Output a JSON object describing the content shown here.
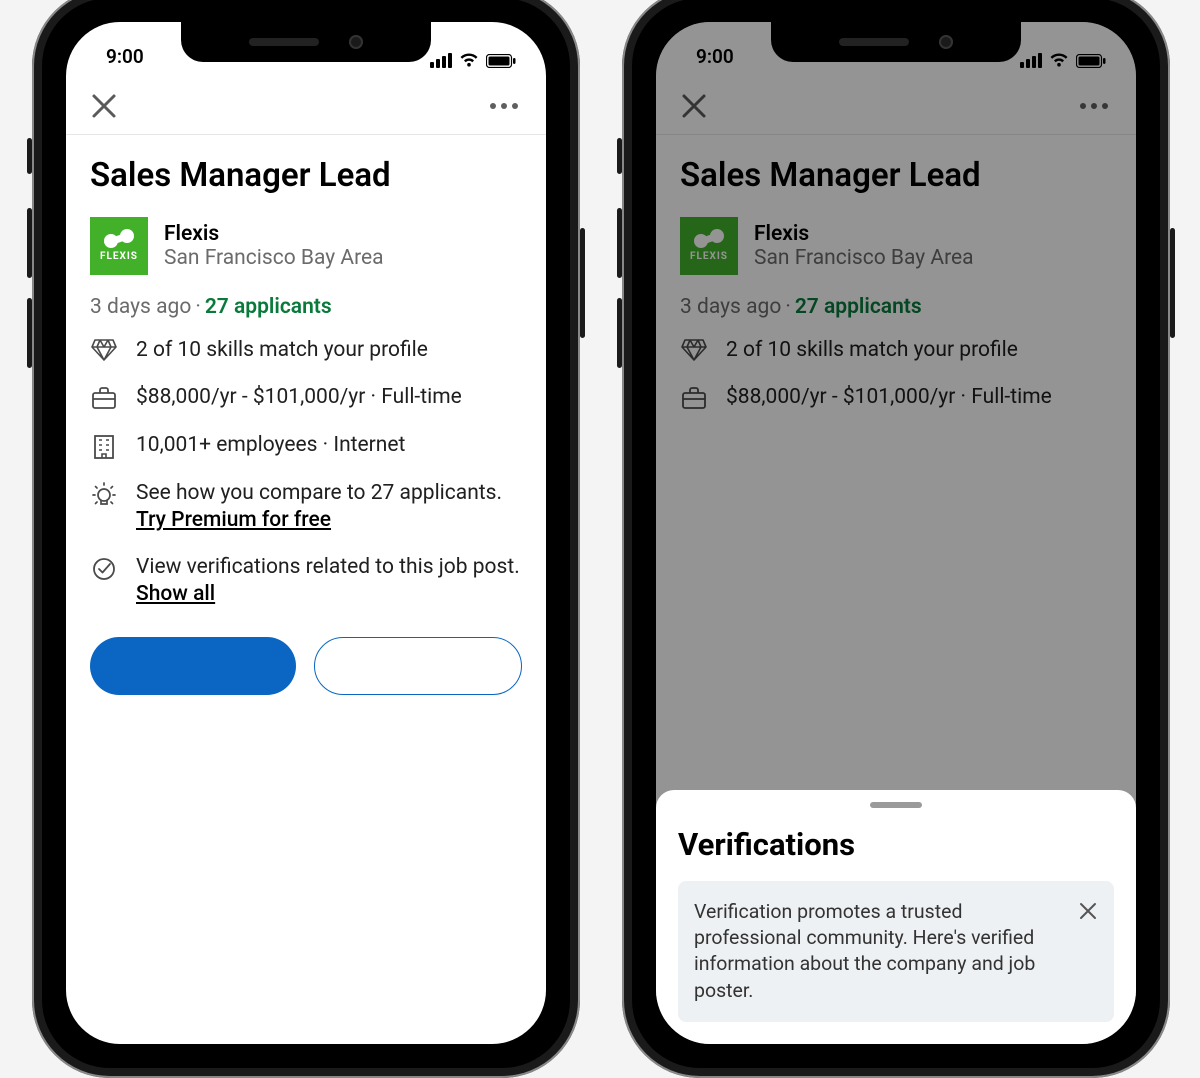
{
  "status": {
    "time": "9:00"
  },
  "job": {
    "title": "Sales Manager Lead",
    "company": {
      "name": "Flexis",
      "logo_label": "FLEXIS",
      "location": "San Francisco Bay Area"
    },
    "posted": "3 days ago",
    "applicants": "27 applicants",
    "skills": "2 of 10 skills match your profile",
    "salary": "$88,000/yr - $101,000/yr · Full-time",
    "company_size": "10,001+ employees · Internet",
    "compare_text": "See how you compare to 27 applicants.",
    "compare_link": "Try Premium for free",
    "verify_text": "View verifications related to this job post.",
    "verify_link": "Show all"
  },
  "sheet": {
    "title": "Verifications",
    "info": "Verification promotes a trusted professional community. Here's verified information about the company and job poster."
  }
}
